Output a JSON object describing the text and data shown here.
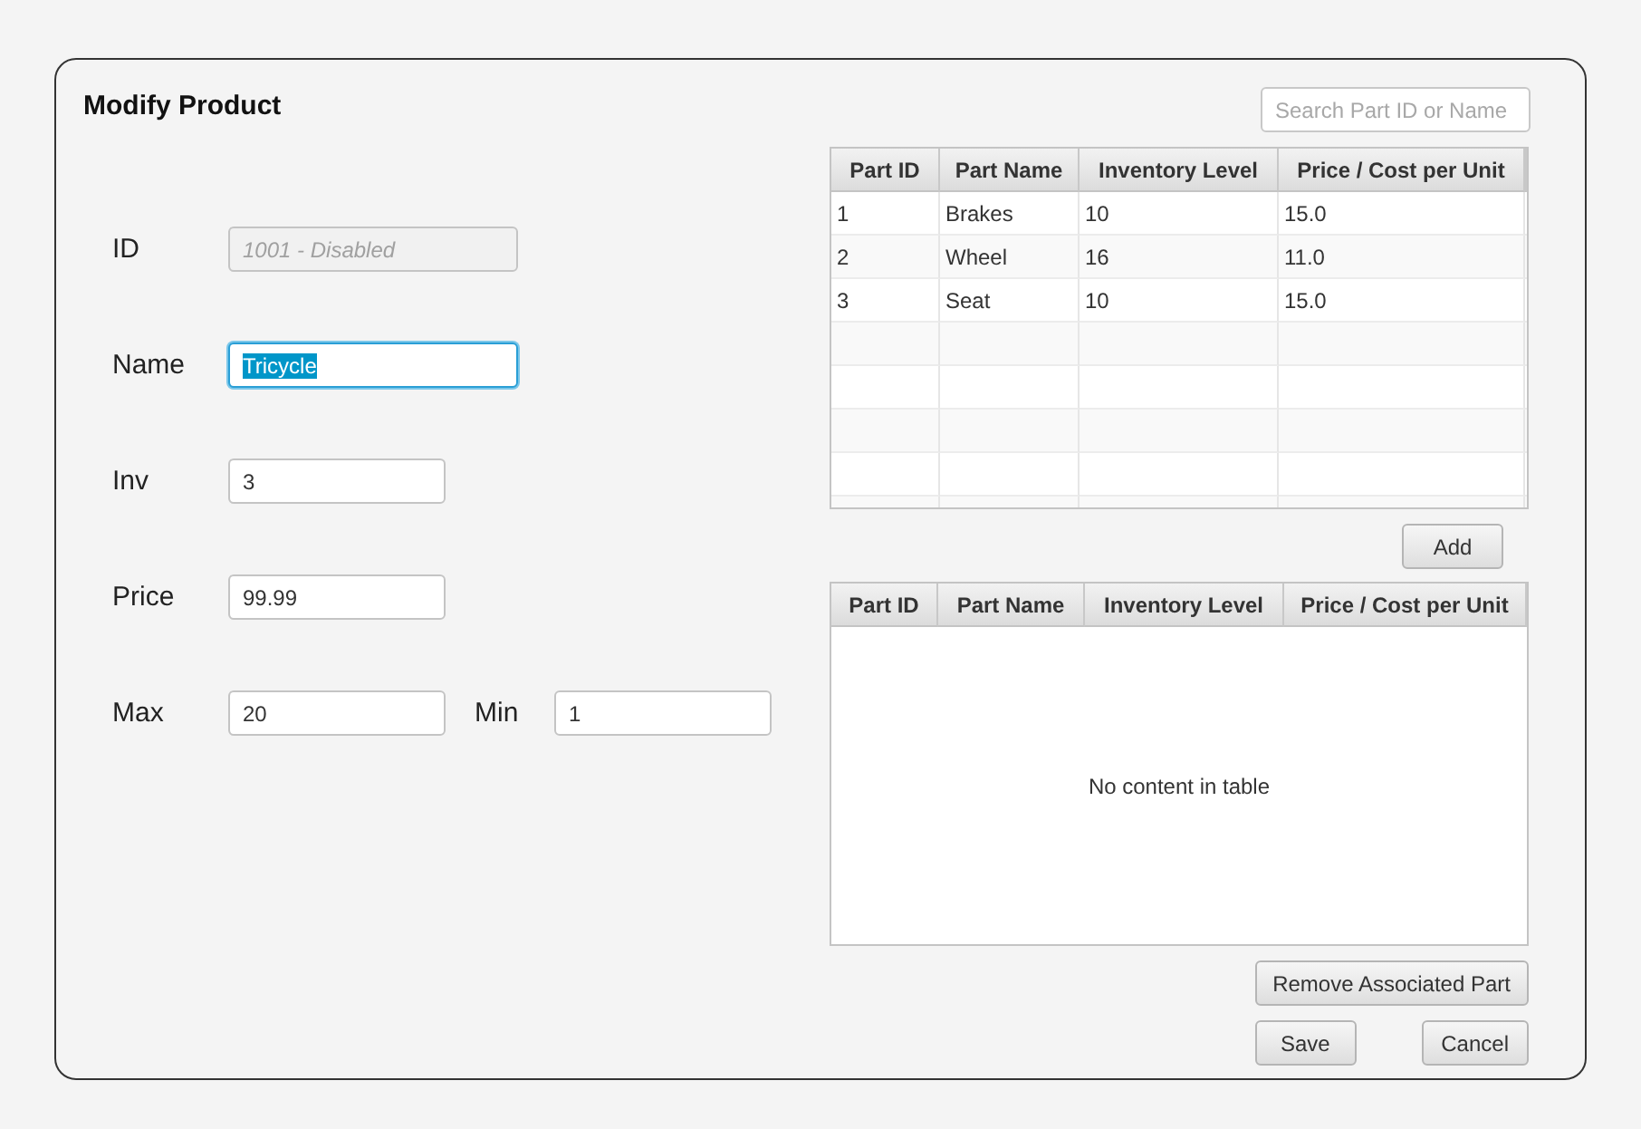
{
  "title": "Modify Product",
  "form_rows": [
    {
      "fields": [
        {
          "label": "ID",
          "placeholder": "1001 - Disabled",
          "disabled": true,
          "focused": false
        }
      ]
    },
    {
      "fields": [
        {
          "label": "Name",
          "value": "Tricycle",
          "disabled": false,
          "focused": true,
          "text_selected": true
        }
      ]
    },
    {
      "fields": [
        {
          "label": "Inv",
          "value": "3",
          "disabled": false,
          "focused": false
        }
      ]
    },
    {
      "fields": [
        {
          "label": "Price",
          "value": "99.99",
          "disabled": false,
          "focused": false
        }
      ]
    },
    {
      "fields": [
        {
          "label": "Max",
          "value": "20",
          "disabled": false,
          "focused": false
        },
        {
          "label": "Min",
          "value": "1",
          "disabled": false,
          "focused": false
        }
      ]
    }
  ],
  "search": {
    "placeholder": "Search Part ID or Name"
  },
  "parts_table": {
    "columns": [
      "Part ID",
      "Part Name",
      "Inventory Level",
      "Price / Cost per Unit"
    ],
    "rows": [
      [
        "1",
        "Brakes",
        "10",
        "15.0"
      ],
      [
        "2",
        "Wheel",
        "16",
        "11.0"
      ],
      [
        "3",
        "Seat",
        "10",
        "15.0"
      ]
    ]
  },
  "add_button": "Add",
  "associated_table": {
    "columns": [
      "Part ID",
      "Part Name",
      "Inventory Level",
      "Price / Cost per Unit"
    ],
    "empty_message": "No content in table"
  },
  "buttons": [
    "Remove Associated Part",
    "Save",
    "Cancel"
  ]
}
